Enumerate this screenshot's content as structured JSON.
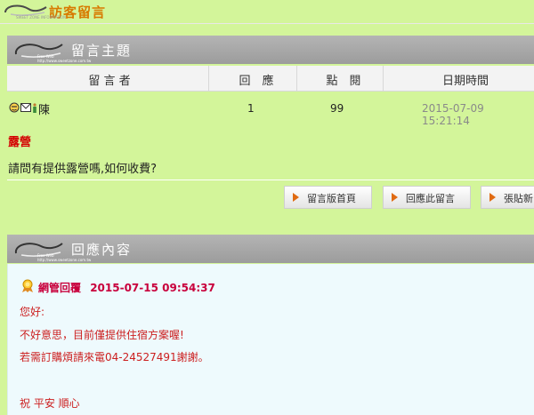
{
  "header": {
    "title": "訪客留言",
    "brand_small": "SWEET ZONE INFORMATION"
  },
  "section1": {
    "title": "留言主題",
    "brand": "Free Web",
    "brand_url": "http://www.sweetzone.com.tw"
  },
  "table": {
    "headers": [
      "留 言 者",
      "回　應",
      "點　閱",
      "日期時間"
    ],
    "row": {
      "author": "陳",
      "replies": "1",
      "views": "99",
      "datetime": "2015-07-09 15:21:14"
    }
  },
  "post": {
    "subject": "露營",
    "body": "請問有提供露營嗎,如何收費?"
  },
  "buttons": [
    "留言版首頁",
    "回應此留言",
    "張貼新"
  ],
  "section2": {
    "title": "回應內容",
    "brand": "Free Web",
    "brand_url": "http://www.sweetzone.com.tw"
  },
  "reply": {
    "author": "網管回覆",
    "datetime": "2015-07-15 09:54:37",
    "lines": [
      "您好:",
      "不好意思，目前僅提供住宿方案喔!",
      "若需訂購煩請來電04-24527491謝謝。",
      "",
      "祝 平安 順心"
    ]
  },
  "icons": [
    "face-icon",
    "mail-icon",
    "person-icon",
    "award-icon"
  ],
  "colors": {
    "background": "#d3f59a",
    "accent": "#d87a00",
    "subject": "#d40000",
    "reply_text": "#cc1f1f",
    "bar": "#a8a8a8"
  }
}
